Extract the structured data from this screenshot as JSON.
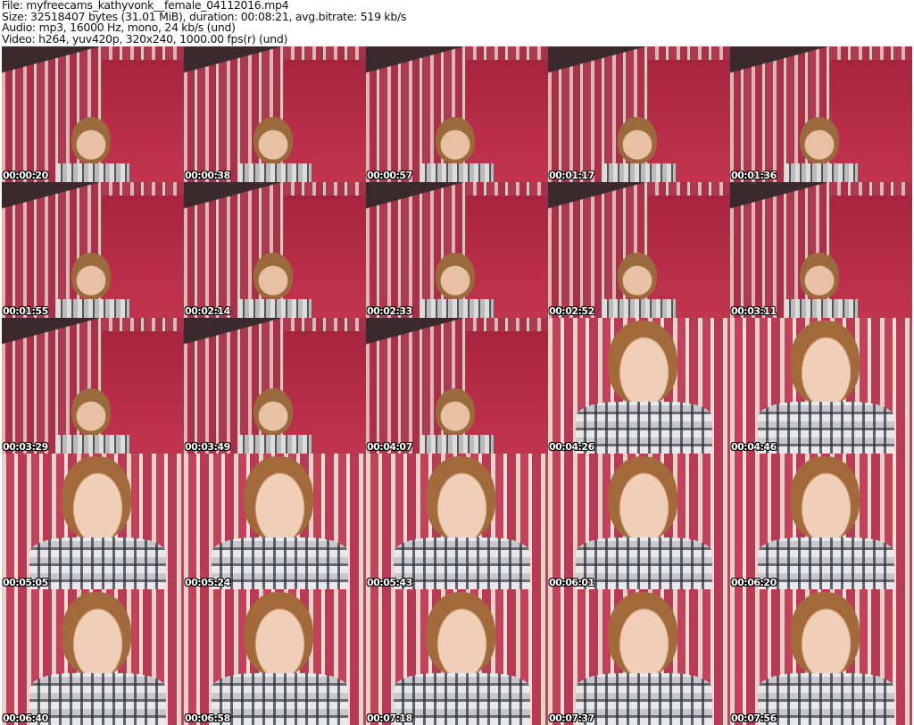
{
  "header": {
    "file": "File: myfreecams_kathyvonk__female_04112016.mp4",
    "size": "Size: 32518407 bytes (31.01 MiB), duration: 00:08:21, avg.bitrate: 519 kb/s",
    "audio": "Audio: mp3, 16000 Hz, mono, 24 kb/s (und)",
    "video": "Video: h264, yuv420p, 320x240, 1000.00 fps(r) (und)"
  },
  "thumbnails": [
    {
      "time": "00:00:20",
      "shot": "far"
    },
    {
      "time": "00:00:38",
      "shot": "far"
    },
    {
      "time": "00:00:57",
      "shot": "far"
    },
    {
      "time": "00:01:17",
      "shot": "far"
    },
    {
      "time": "00:01:36",
      "shot": "far"
    },
    {
      "time": "00:01:55",
      "shot": "far"
    },
    {
      "time": "00:02:14",
      "shot": "far"
    },
    {
      "time": "00:02:33",
      "shot": "far"
    },
    {
      "time": "00:02:52",
      "shot": "far"
    },
    {
      "time": "00:03:11",
      "shot": "far"
    },
    {
      "time": "00:03:29",
      "shot": "far"
    },
    {
      "time": "00:03:49",
      "shot": "far"
    },
    {
      "time": "00:04:07",
      "shot": "far"
    },
    {
      "time": "00:04:26",
      "shot": "near"
    },
    {
      "time": "00:04:46",
      "shot": "near"
    },
    {
      "time": "00:05:05",
      "shot": "near"
    },
    {
      "time": "00:05:24",
      "shot": "near"
    },
    {
      "time": "00:05:43",
      "shot": "near"
    },
    {
      "time": "00:06:01",
      "shot": "near"
    },
    {
      "time": "00:06:20",
      "shot": "near"
    },
    {
      "time": "00:06:40",
      "shot": "near"
    },
    {
      "time": "00:06:58",
      "shot": "near"
    },
    {
      "time": "00:07:18",
      "shot": "near"
    },
    {
      "time": "00:07:37",
      "shot": "near"
    },
    {
      "time": "00:07:56",
      "shot": "near"
    }
  ]
}
